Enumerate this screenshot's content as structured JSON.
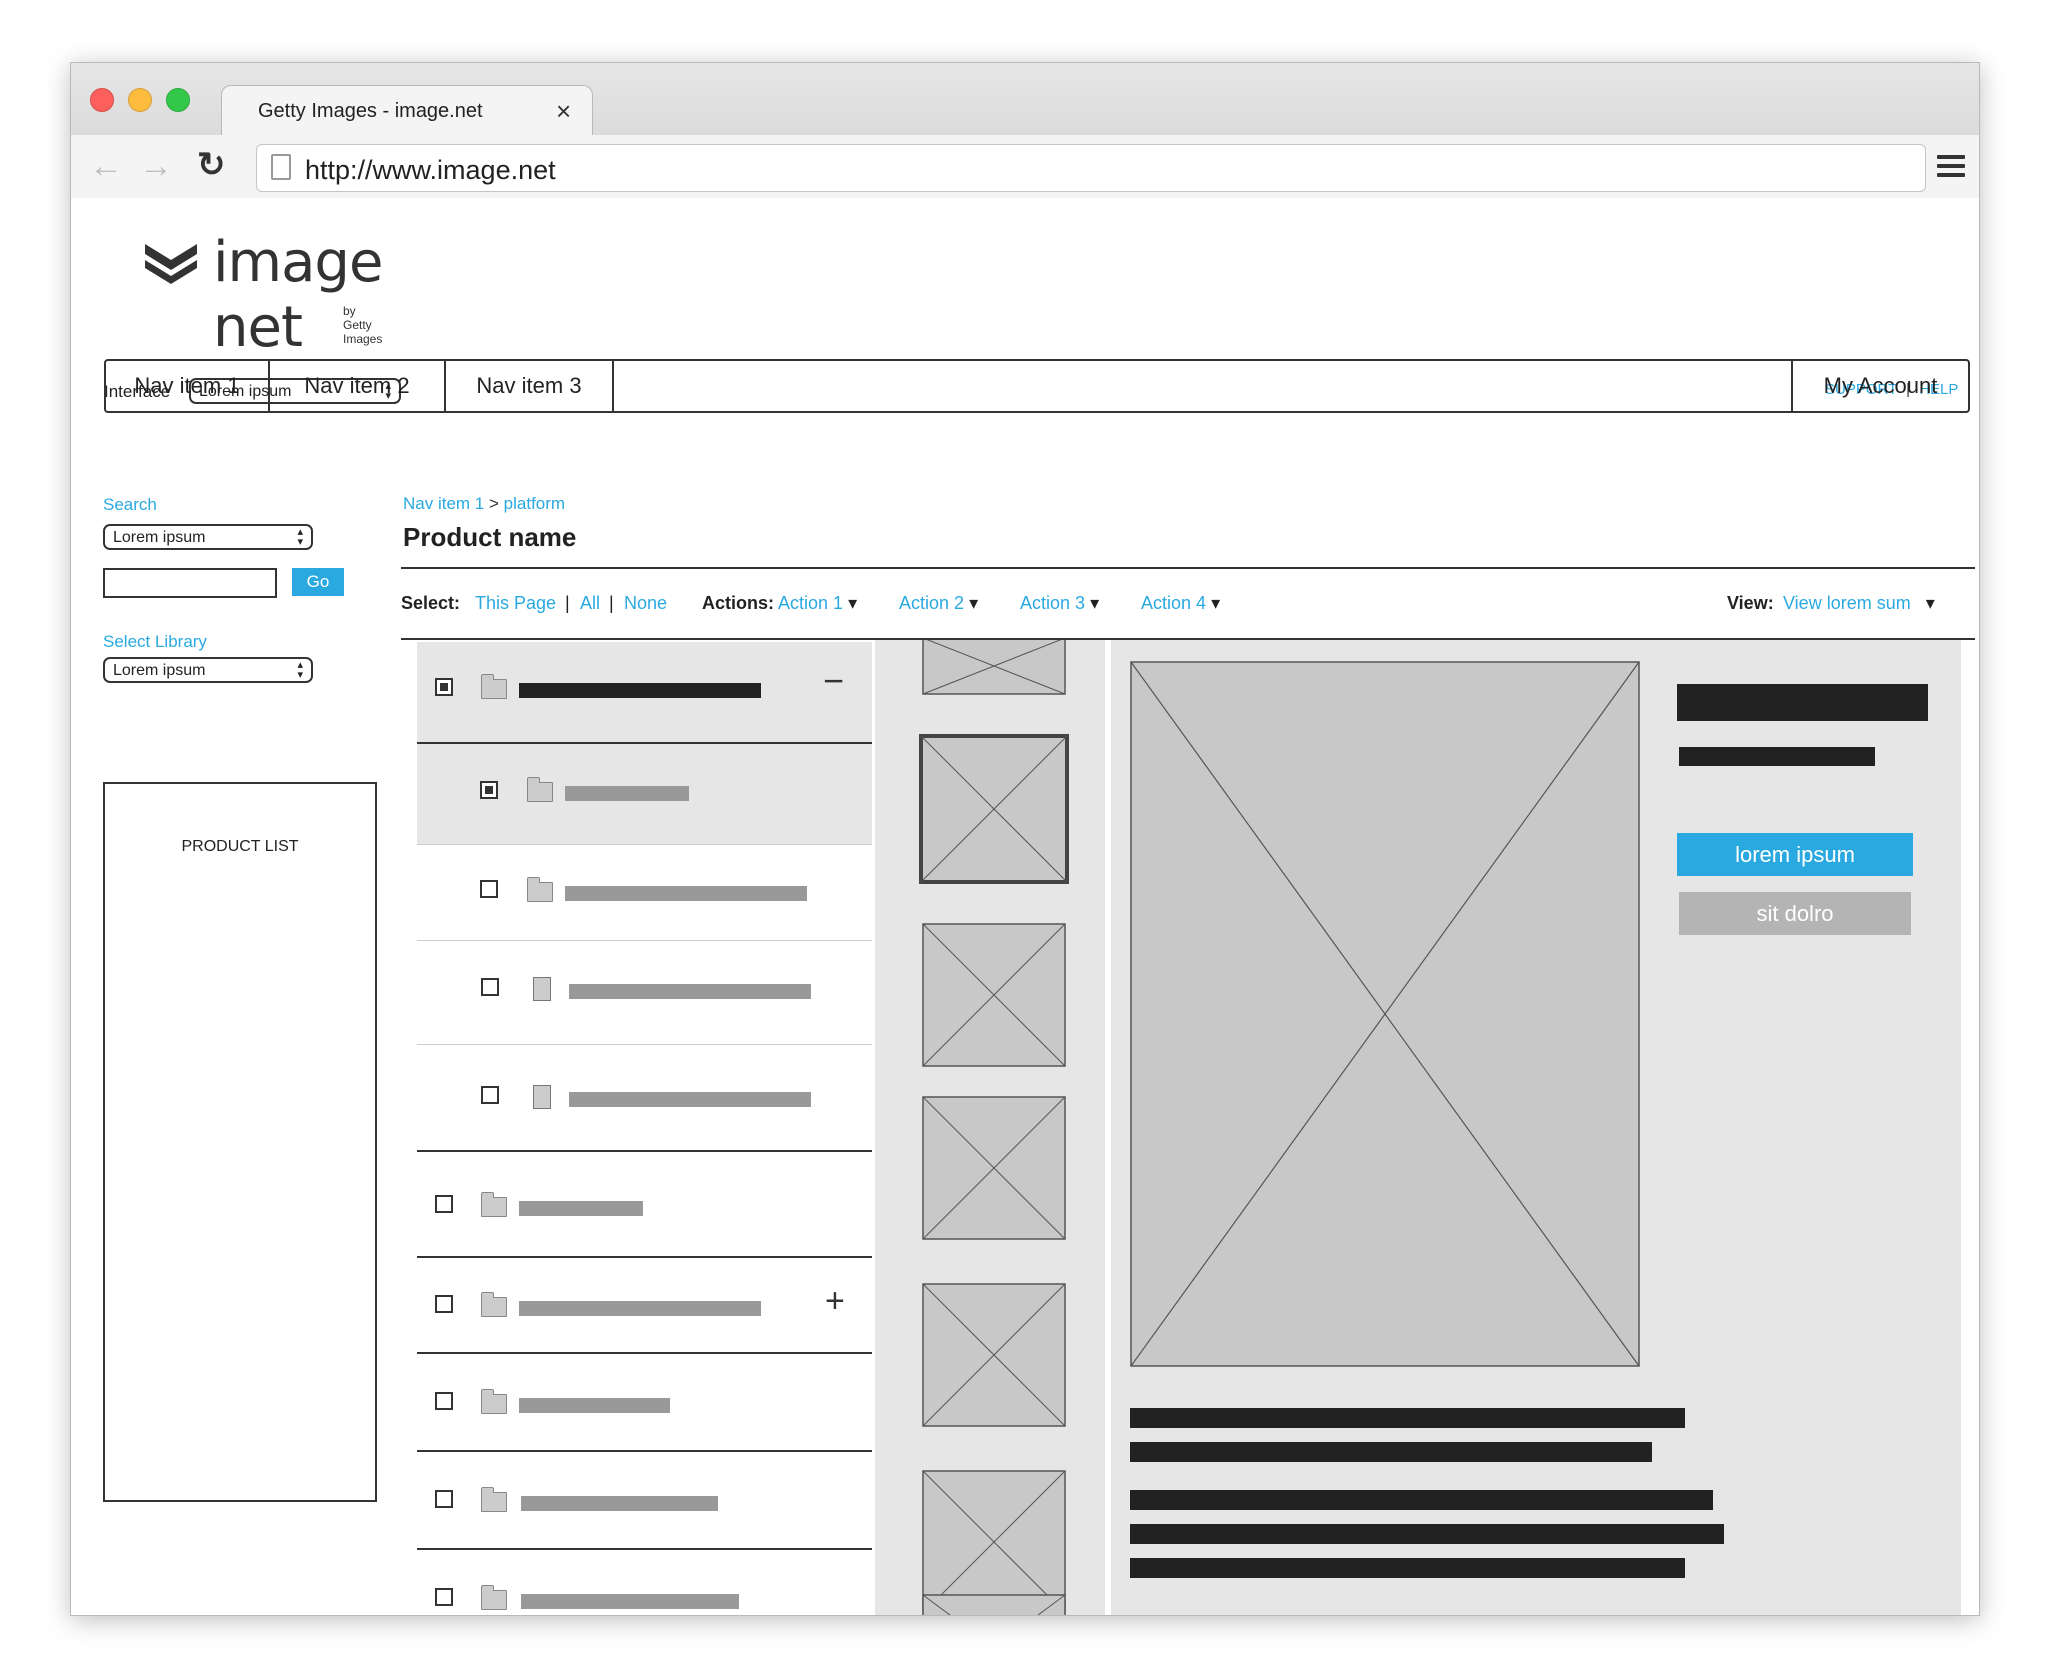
{
  "browser": {
    "tab_title": "Getty Images - image.net",
    "tab_close": "×",
    "url": "http://www.image.net",
    "back_glyph": "←",
    "forward_glyph": "→",
    "reload_glyph": "↻"
  },
  "logo": {
    "text": "image net",
    "subtext": "by Getty Images"
  },
  "interface": {
    "label": "Interface",
    "value": "Lorem ipsum"
  },
  "top_links": {
    "support": "SUPPORT",
    "separator": "|",
    "help": "HELP"
  },
  "nav": {
    "items": [
      "Nav item 1",
      "Nav item 2",
      "Nav item 3"
    ],
    "account": "My Account"
  },
  "sidebar": {
    "search_label": "Search",
    "search_select": "Lorem ipsum",
    "go_label": "Go",
    "library_label": "Select Library",
    "library_select": "Lorem ipsum",
    "product_list_label": "PRODUCT LIST"
  },
  "breadcrumb": {
    "item1": "Nav item 1",
    "separator": ">",
    "item2": "platform"
  },
  "page_title": "Product name",
  "actions_bar": {
    "select_label": "Select:",
    "this_page": "This Page",
    "sep": "|",
    "all": "All",
    "none": "None",
    "actions_label": "Actions:",
    "actions": [
      "Action 1",
      "Action 2",
      "Action 3",
      "Action 4"
    ],
    "caret": "▾",
    "view_label": "View:",
    "view_value": "View lorem sum"
  },
  "list": {
    "expand_minus": "−",
    "expand_plus": "+"
  },
  "detail": {
    "primary_button": "lorem ipsum",
    "secondary_button": "sit dolro"
  },
  "colors": {
    "accent": "#29a9e0",
    "panel_bg": "#e6e6e6",
    "placeholder": "#c8c8c9"
  }
}
